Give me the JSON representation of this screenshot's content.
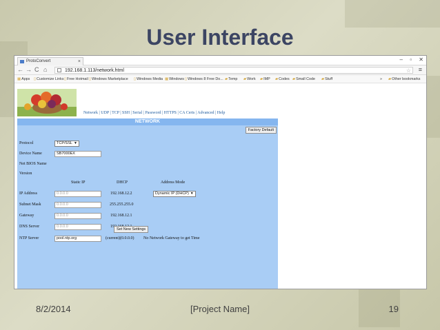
{
  "slide": {
    "title": "User Interface",
    "footer": {
      "date": "8/2/2014",
      "project": "[Project Name]",
      "page": "19"
    }
  },
  "browser": {
    "tab_title": "ProtoConvert",
    "tab_close": "×",
    "window_controls": [
      "–",
      "▫",
      "✕"
    ],
    "address": "192.168.1.113/network.html",
    "bookmarks": [
      "Apps",
      "Customize Links",
      "Free Hotmail",
      "Windows Marketplace",
      "Windows Media",
      "Windows",
      "Windows 8 Free Do...",
      "Temp",
      "Work",
      "IMP",
      "Codes",
      "Small Code",
      "Stuff"
    ],
    "more_bookmarks": "»",
    "other_bookmarks": "Other bookmarks"
  },
  "app": {
    "nav_links": "Network | UDP | TCP | SSH | Serial | Password | HTTPS | CA Certs | Advanced | Help",
    "section_title": "NETWORK",
    "factory_default": "Factory Default",
    "labels": {
      "protocol": "Protocol",
      "device_name": "Device Name",
      "netbios_name": "Net BIOS Name",
      "version": "Version",
      "ip_address": "IP Address",
      "subnet_mask": "Subnet Mask",
      "gateway": "Gateway",
      "dns_server": "DNS Server",
      "ntp_server": "NTP Server"
    },
    "columns": {
      "static_ip": "Static IP",
      "dhcp": "DHCP",
      "address_mode": "Address Mode"
    },
    "values": {
      "protocol": "TCP/SSL",
      "device_name": "SB7000EX",
      "ip_static_placeholder": "0.0.0.0",
      "subnet_static_placeholder": "0.0.0.0",
      "gateway_static_placeholder": "0.0.0.0",
      "dns_static_placeholder": "0.0.0.0",
      "ip_dhcp": "192.168.12.2",
      "subnet_dhcp": "255.255.255.0",
      "gateway_dhcp": "192.168.12.1",
      "dns_dhcp": "192.168.12.1",
      "address_mode": "Dynamic IP (DHCP)",
      "ntp_server": "pool.ntp.org",
      "ntp_current": "(current)(0.0.0.0)",
      "ntp_status": "No Network Gateway to get Time"
    },
    "set_button": "Set New Settings"
  }
}
